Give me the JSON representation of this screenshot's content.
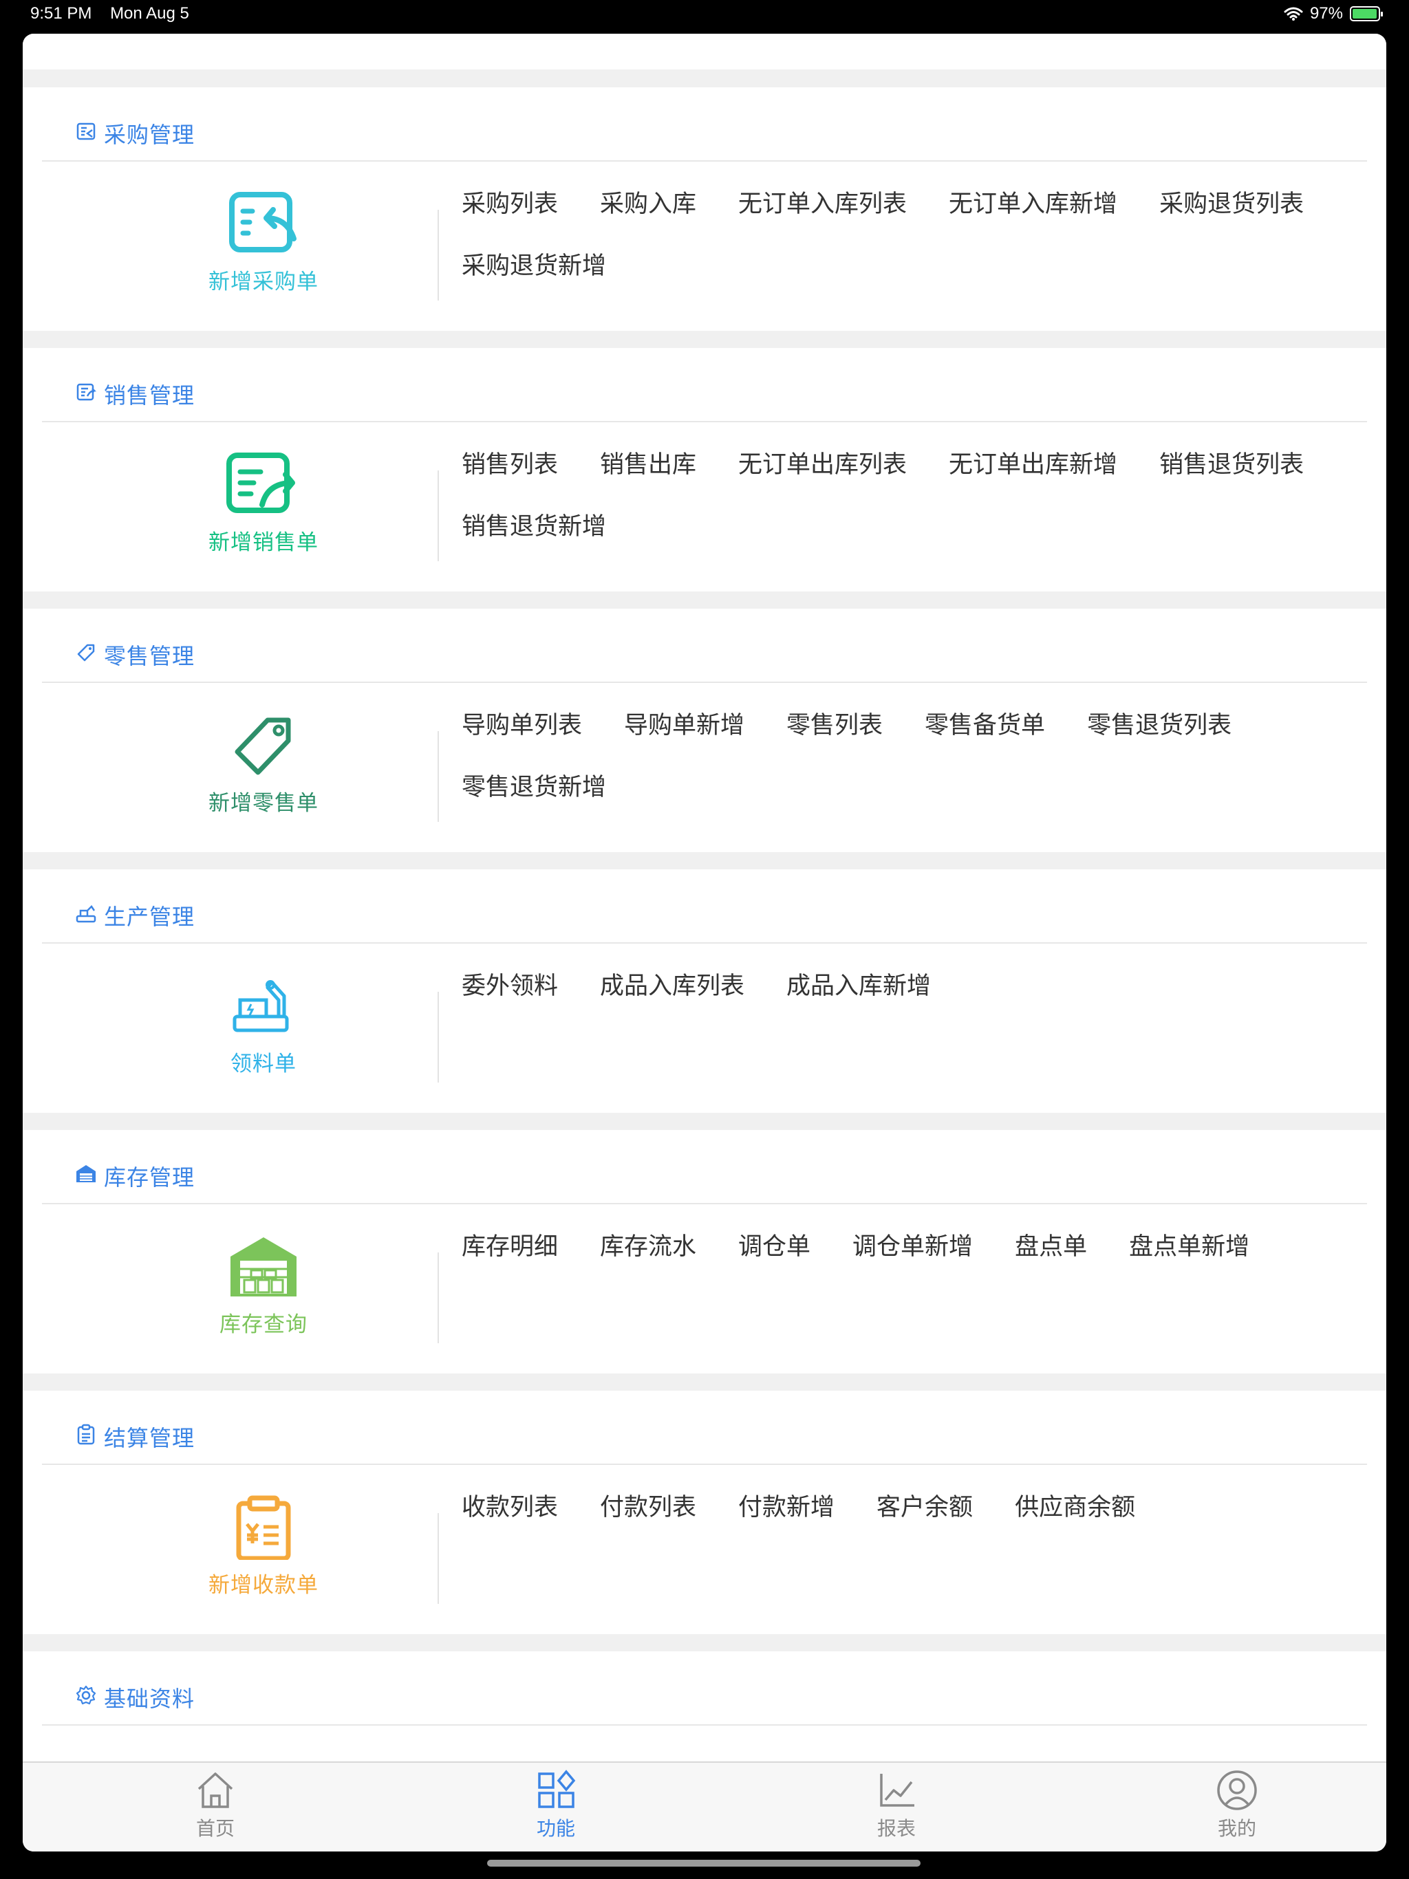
{
  "status_bar": {
    "time": "9:51 PM",
    "date": "Mon Aug 5",
    "battery": "97%",
    "battery_level": 0.97
  },
  "sections": [
    {
      "title": "采购管理",
      "icon": "purchase-icon",
      "button_label": "新增采购单",
      "button_icon": "new-purchase-icon",
      "button_color": "#34c1d7",
      "links": [
        "采购列表",
        "采购入库",
        "无订单入库列表",
        "无订单入库新增",
        "采购退货列表",
        "采购退货新增"
      ]
    },
    {
      "title": "销售管理",
      "icon": "sales-icon",
      "button_label": "新增销售单",
      "button_icon": "new-sales-icon",
      "button_color": "#16c083",
      "links": [
        "销售列表",
        "销售出库",
        "无订单出库列表",
        "无订单出库新增",
        "销售退货列表",
        "销售退货新增"
      ]
    },
    {
      "title": "零售管理",
      "icon": "retail-tag-icon",
      "button_label": "新增零售单",
      "button_icon": "tag-icon",
      "button_color": "#2e8f6a",
      "links": [
        "导购单列表",
        "导购单新增",
        "零售列表",
        "零售备货单",
        "零售退货列表",
        "零售退货新增"
      ]
    },
    {
      "title": "生产管理",
      "icon": "production-icon",
      "button_label": "领料单",
      "button_icon": "robot-arm-icon",
      "button_color": "#2fb2e8",
      "links": [
        "委外领料",
        "成品入库列表",
        "成品入库新增"
      ]
    },
    {
      "title": "库存管理",
      "icon": "warehouse-icon",
      "button_label": "库存查询",
      "button_icon": "warehouse-big-icon",
      "button_color": "#7cc45a",
      "links": [
        "库存明细",
        "库存流水",
        "调仓单",
        "调仓单新增",
        "盘点单",
        "盘点单新增"
      ]
    },
    {
      "title": "结算管理",
      "icon": "settlement-icon",
      "button_label": "新增收款单",
      "button_icon": "receipt-icon",
      "button_color": "#f5a93b",
      "links": [
        "收款列表",
        "付款列表",
        "付款新增",
        "客户余额",
        "供应商余额"
      ]
    },
    {
      "title": "基础资料",
      "icon": "gear-icon",
      "button_label": "",
      "button_icon": "",
      "button_color": "#3b84e5",
      "links": []
    }
  ],
  "tabs": [
    {
      "label": "首页",
      "icon": "home-icon",
      "active": false
    },
    {
      "label": "功能",
      "icon": "apps-icon",
      "active": true
    },
    {
      "label": "报表",
      "icon": "chart-icon",
      "active": false
    },
    {
      "label": "我的",
      "icon": "user-icon",
      "active": false
    }
  ],
  "colors": {
    "accent": "#3b84e5",
    "tab_inactive": "#8a8a8a",
    "background": "#f0f0f0"
  }
}
